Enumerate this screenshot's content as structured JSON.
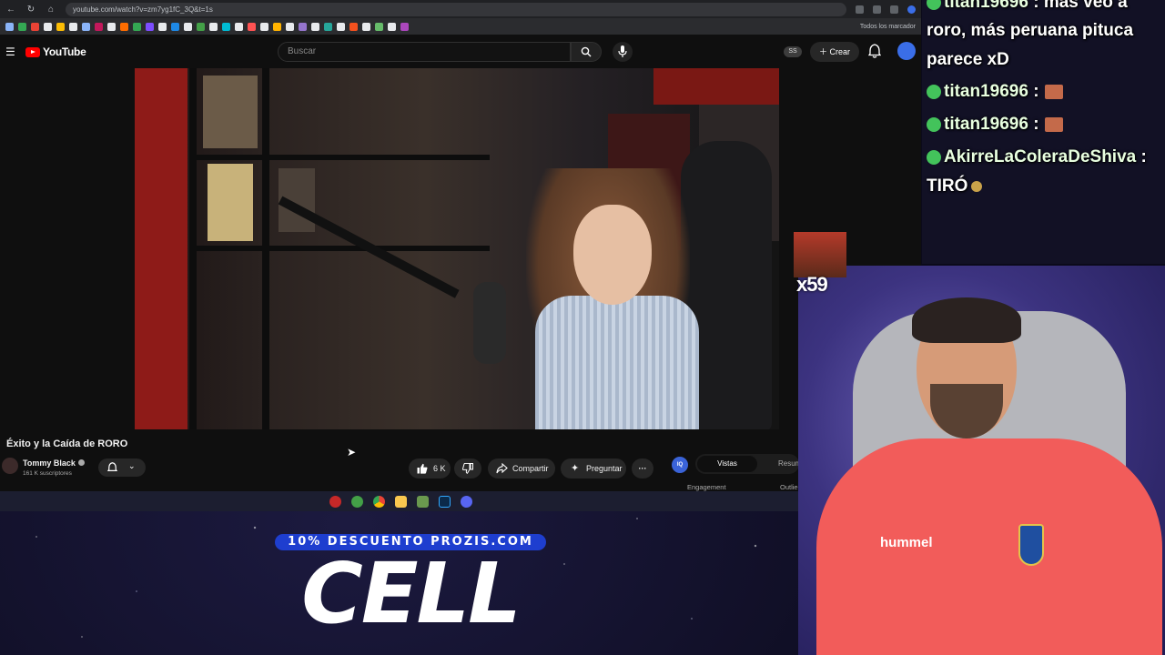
{
  "browser": {
    "url": "youtube.com/watch?v=zm7yg1fC_3Q&t=1s",
    "bookmarks_all": "Todos los marcador"
  },
  "youtube": {
    "brand": "YouTube",
    "search_placeholder": "Buscar",
    "badge": "SS",
    "create_label": "Crear",
    "video_title": "Éxito y la Caída de RORO",
    "channel_name": "Tommy Black",
    "subscribers": "161 K suscriptores",
    "likes": "6 K",
    "share_label": "Compartir",
    "ask_label": "Preguntar",
    "more_label": "···",
    "panel": {
      "iq_label": "IQ",
      "tab_active": "Vistas",
      "tab_other": "Resum",
      "label_left": "Engagement",
      "label_right": "Outlie"
    }
  },
  "promo": {
    "line": "10% DESCUENTO PROZIS.COM",
    "big": "CELL"
  },
  "chat": {
    "messages": [
      {
        "user": "titan19696",
        "text": ": más veo a"
      },
      {
        "text": "roro, más peruana pituca"
      },
      {
        "text": "parece xD"
      },
      {
        "user": "titan19696",
        "text": ":"
      },
      {
        "user": "titan19696",
        "text": ":"
      },
      {
        "user": "AkirreLaColeraDeShiva",
        "text": ":"
      },
      {
        "text": "TIRÓ"
      }
    ]
  },
  "overlay": {
    "meme_count": "x59"
  },
  "webcam": {
    "shirt_brand": "hummel"
  },
  "colors": {
    "youtube_red": "#ff0000",
    "promo_blue": "#1e3ecf",
    "chat_badge": "#43c35b",
    "shirt": "#f25c5a"
  }
}
